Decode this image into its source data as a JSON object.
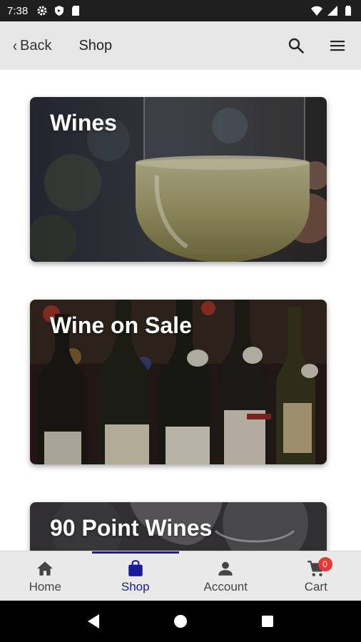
{
  "status_bar": {
    "time": "7:38",
    "icons_left": [
      "settings-icon",
      "shield-icon",
      "sd-card-icon"
    ],
    "icons_right": [
      "wifi-icon",
      "signal-icon",
      "battery-icon"
    ]
  },
  "app_bar": {
    "back_label": "Back",
    "title": "Shop",
    "actions": [
      "search-icon",
      "menu-icon"
    ]
  },
  "categories": [
    {
      "label": "Wines",
      "image": "white wine glass"
    },
    {
      "label": "Wine on Sale",
      "image": "row of wine bottles"
    },
    {
      "label": "90 Point Wines",
      "image": "wine glasses at table"
    }
  ],
  "bottom_nav": {
    "items": [
      {
        "label": "Home",
        "icon": "home-icon",
        "active": false
      },
      {
        "label": "Shop",
        "icon": "shopping-bag-icon",
        "active": true
      },
      {
        "label": "Account",
        "icon": "account-icon",
        "active": false
      },
      {
        "label": "Cart",
        "icon": "cart-icon",
        "active": false,
        "badge": "0"
      }
    ]
  },
  "colors": {
    "accent": "#1a1aa0",
    "badge": "#e53935",
    "app_bar_bg": "#e6e6e6",
    "status_bar_bg": "#1f1f1f"
  }
}
